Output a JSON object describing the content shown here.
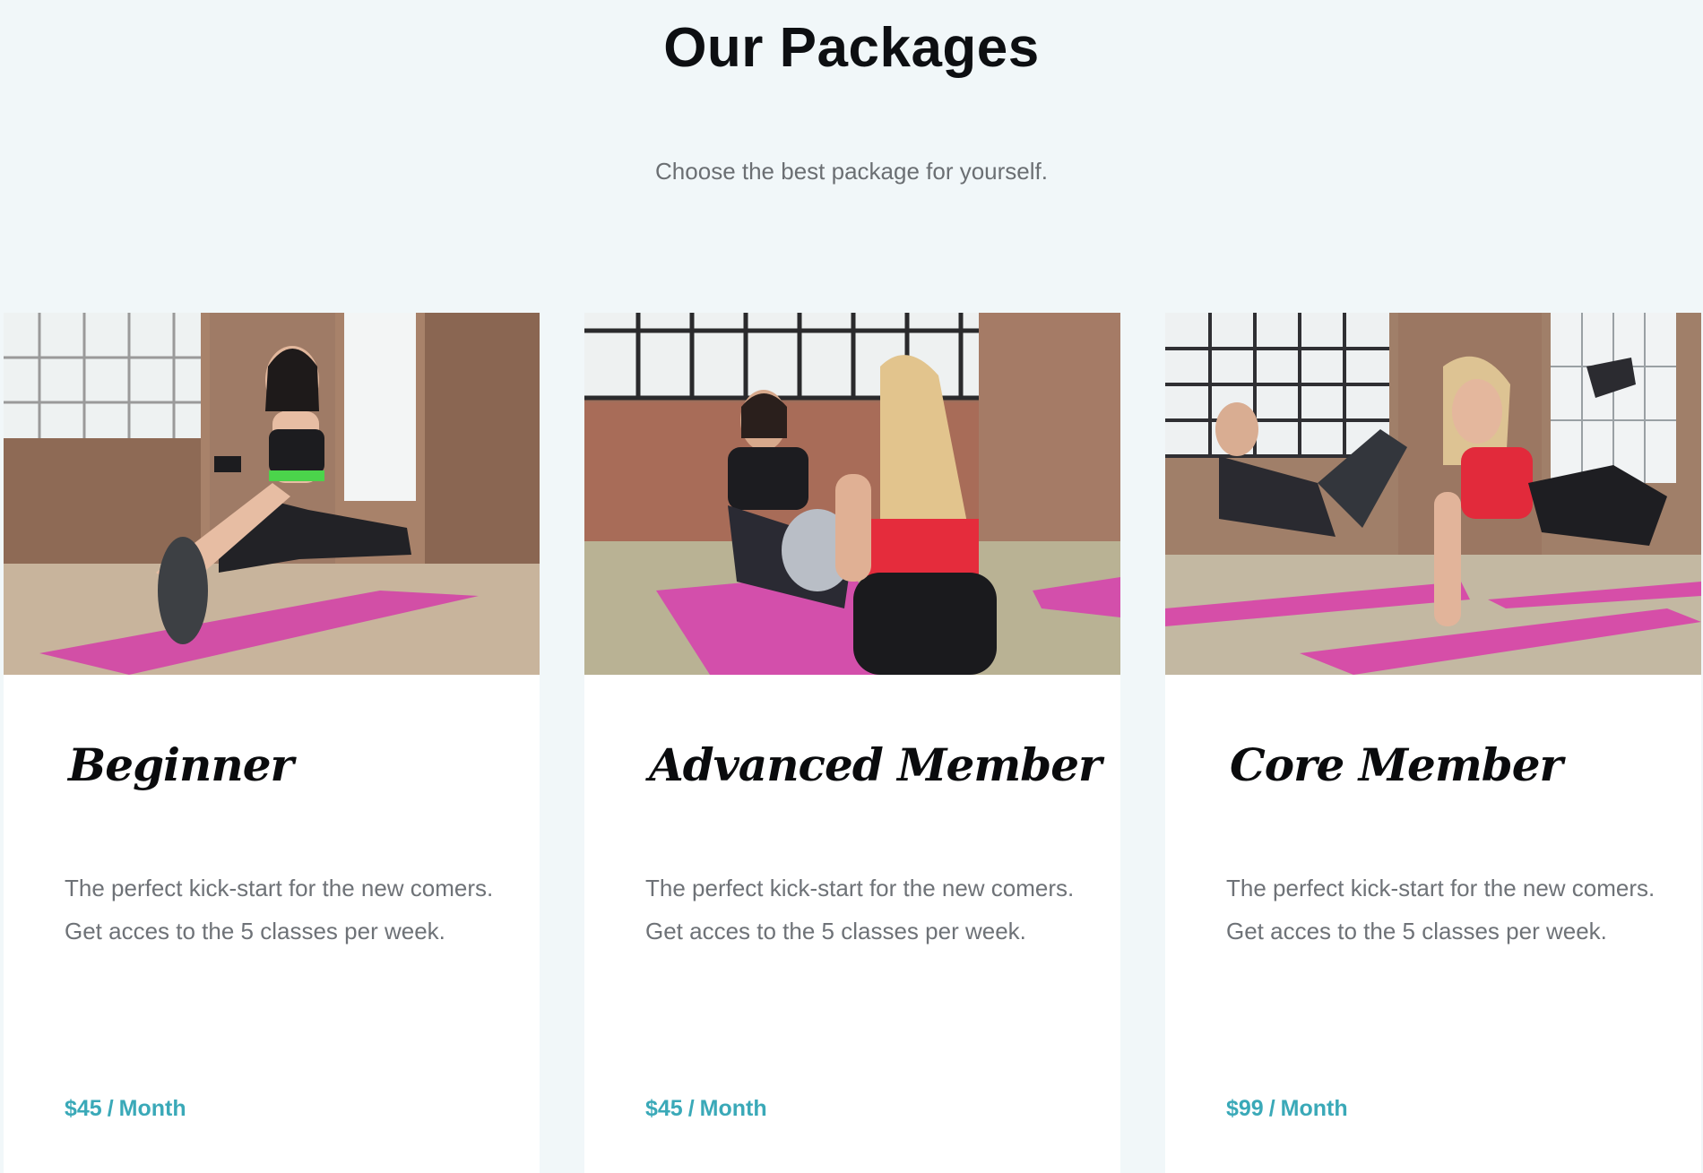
{
  "header": {
    "title": "Our Packages",
    "subtitle": "Choose the best package for yourself."
  },
  "accent_color": "#3aa9b8",
  "packages": [
    {
      "name": "Beginner",
      "description": "The perfect kick-start for the new comers. Get acces to the 5 classes per week.",
      "price": "$45",
      "period": "Month",
      "separator": "/"
    },
    {
      "name": "Advanced Member",
      "description": "The perfect kick-start for the new comers. Get acces to the 5 classes per week.",
      "price": "$45",
      "period": "Month",
      "separator": "/"
    },
    {
      "name": "Core Member",
      "description": "The perfect kick-start for the new comers. Get acces to the 5 classes per week.",
      "price": "$99",
      "period": "Month",
      "separator": "/"
    }
  ]
}
